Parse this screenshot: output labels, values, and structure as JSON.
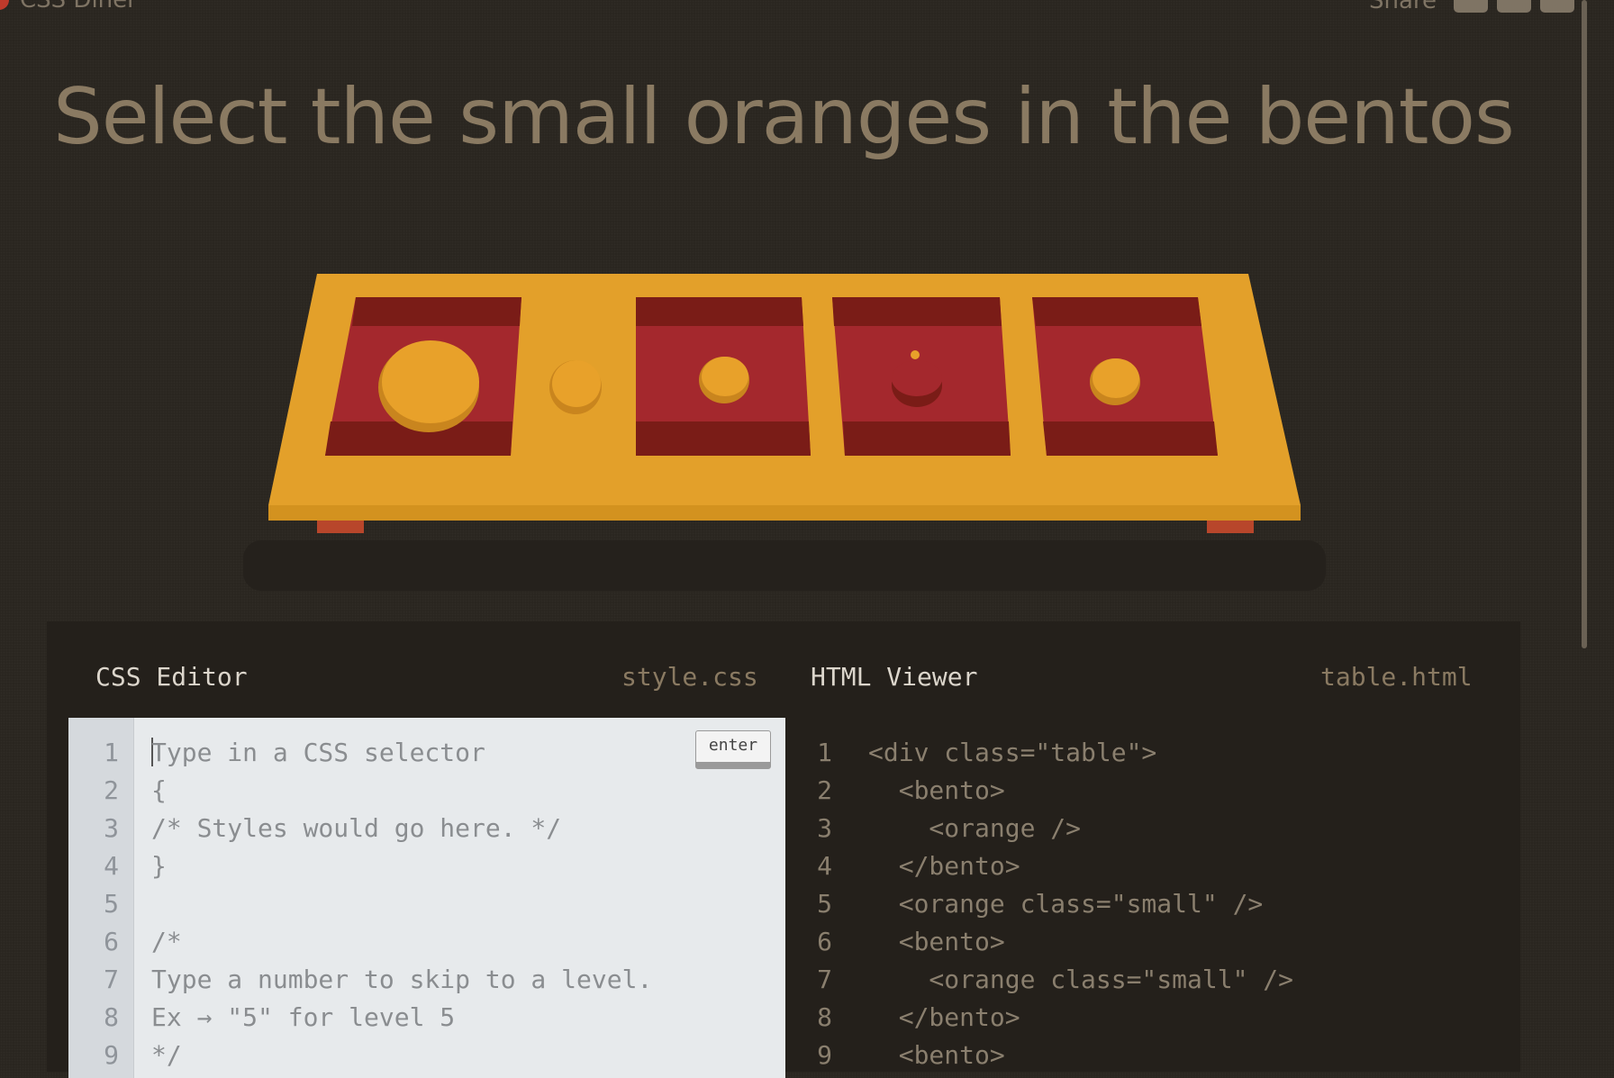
{
  "header": {
    "logo_text": "CSS Diner",
    "share_label": "Share",
    "social_icons": [
      "email-icon",
      "facebook-icon",
      "twitter-icon"
    ]
  },
  "level": {
    "instruction": "Select the small oranges in the bentos"
  },
  "table_scene": {
    "items": [
      "bento with orange",
      "small orange",
      "bento with small orange",
      "bento",
      "bento with small orange"
    ],
    "colors": {
      "table": "#e3a02a",
      "bento": "#a4282d",
      "orange": "#e3a02a"
    }
  },
  "css_editor": {
    "title": "CSS Editor",
    "filename": "style.css",
    "enter_label": "enter",
    "input_placeholder": "Type in a CSS selector",
    "lines": [
      {
        "n": "1",
        "text": "Type in a CSS selector"
      },
      {
        "n": "2",
        "text": "{"
      },
      {
        "n": "3",
        "text": "/* Styles would go here. */"
      },
      {
        "n": "4",
        "text": "}"
      },
      {
        "n": "5",
        "text": ""
      },
      {
        "n": "6",
        "text": "/*"
      },
      {
        "n": "7",
        "text": "Type a number to skip to a level."
      },
      {
        "n": "8",
        "text": "Ex → \"5\" for level 5"
      },
      {
        "n": "9",
        "text": "*/"
      }
    ]
  },
  "html_viewer": {
    "title": "HTML Viewer",
    "filename": "table.html",
    "lines": [
      {
        "n": "1",
        "text": "<div class=\"table\">"
      },
      {
        "n": "2",
        "text": "  <bento>"
      },
      {
        "n": "3",
        "text": "    <orange />"
      },
      {
        "n": "4",
        "text": "  </bento>"
      },
      {
        "n": "5",
        "text": "  <orange class=\"small\" />"
      },
      {
        "n": "6",
        "text": "  <bento>"
      },
      {
        "n": "7",
        "text": "    <orange class=\"small\" />"
      },
      {
        "n": "8",
        "text": "  </bento>"
      },
      {
        "n": "9",
        "text": "  <bento>"
      }
    ]
  }
}
